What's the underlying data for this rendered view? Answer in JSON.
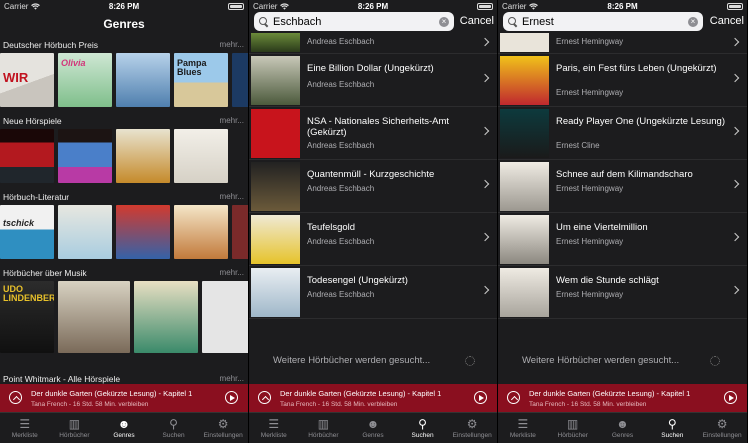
{
  "status": {
    "carrier": "Carrier",
    "time": "8:26 PM"
  },
  "genres_screen": {
    "title": "Genres",
    "sections": [
      {
        "label": "Deutscher Hörbuch Preis",
        "more": "mehr..."
      },
      {
        "label": "Neue Hörspiele",
        "more": "mehr..."
      },
      {
        "label": "Hörbuch-Literatur",
        "more": "mehr..."
      },
      {
        "label": "Hörbücher über Musik",
        "more": "mehr..."
      },
      {
        "label": "Point Whitmark - Alle Hörspiele",
        "more": "mehr..."
      }
    ]
  },
  "search1": {
    "query": "Eschbach",
    "cancel": "Cancel",
    "results": [
      {
        "title": "",
        "author": "Andreas Eschbach"
      },
      {
        "title": "Eine Billion Dollar (Ungekürzt)",
        "author": "Andreas Eschbach"
      },
      {
        "title": "NSA - Nationales Sicherheits-Amt (Gekürzt)",
        "author": "Andreas Eschbach"
      },
      {
        "title": "Quantenmüll - Kurzgeschichte",
        "author": "Andreas Eschbach"
      },
      {
        "title": "Teufelsgold",
        "author": "Andreas Eschbach"
      },
      {
        "title": "Todesengel (Ungekürzt)",
        "author": "Andreas Eschbach"
      }
    ],
    "loading": "Weitere Hörbücher werden gesucht..."
  },
  "search2": {
    "query": "Ernest",
    "cancel": "Cancel",
    "results": [
      {
        "title": "",
        "author": "Ernest Hemingway"
      },
      {
        "title": "Paris, ein Fest fürs Leben (Ungekürzt)",
        "author": "Ernest Hemingway"
      },
      {
        "title": "Ready Player One (Ungekürzte Lesung)",
        "author": "Ernest Cline"
      },
      {
        "title": "Schnee auf dem Kilimandscharo",
        "author": "Ernest Hemingway"
      },
      {
        "title": "Um eine Viertelmillion",
        "author": "Ernest Hemingway"
      },
      {
        "title": "Wem die Stunde schlägt",
        "author": "Ernest Hemingway"
      }
    ],
    "loading": "Weitere Hörbücher werden gesucht..."
  },
  "player": {
    "title": "Der dunkle Garten (Gekürzte Lesung) - Kapitel 1",
    "subtitle": "Tana French - 16 Std. 58 Min. verbleiben"
  },
  "tabs": [
    "Merkliste",
    "Hörbücher",
    "Genres",
    "Suchen",
    "Einstellungen"
  ],
  "colors": {
    "player_bg": "#8a0f1f",
    "background": "#1c1c1e",
    "secondary_text": "#aeaeb2"
  }
}
